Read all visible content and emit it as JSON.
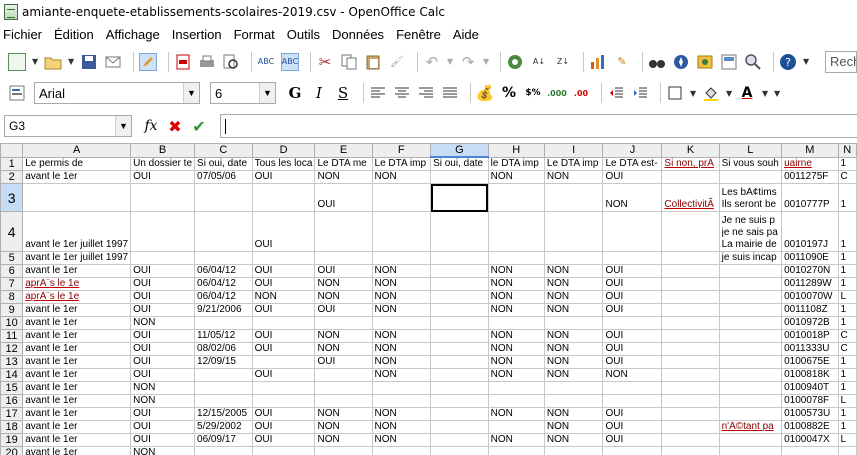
{
  "window": {
    "title": "amiante-enquete-etablissements-scolaires-2019.csv - OpenOffice Calc"
  },
  "menu": [
    "Fichier",
    "Édition",
    "Affichage",
    "Insertion",
    "Format",
    "Outils",
    "Données",
    "Fenêtre",
    "Aide"
  ],
  "search": {
    "placeholder": "Rech"
  },
  "formatting": {
    "font_name": "Arial",
    "font_size": "6",
    "bold_label": "G",
    "italic_label": "I",
    "underline_label": "S",
    "currency": "%",
    "percent": "%"
  },
  "formula_bar": {
    "cell_ref": "G3",
    "fx_label": "fx",
    "value": ""
  },
  "columns": [
    "A",
    "B",
    "C",
    "D",
    "E",
    "F",
    "G",
    "H",
    "I",
    "J",
    "K",
    "L",
    "M",
    "N"
  ],
  "rows": [
    {
      "n": "1",
      "cells": [
        "Le permis de",
        "Un dossier te",
        "Si oui, date",
        "Tous les loca",
        "Le DTA me",
        "Le DTA imp",
        "Si oui, date",
        "le DTA imp",
        "Le DTA imp",
        "Le DTA est-",
        "Si non, prÃ",
        "Si vous souh",
        "uairne",
        "1"
      ]
    },
    {
      "n": "2",
      "cells": [
        "avant le 1er",
        "OUI",
        "07/05/06",
        "OUI",
        "NON",
        "NON",
        "",
        "NON",
        "NON",
        "OUI",
        "",
        "",
        "0011275F",
        "C"
      ]
    },
    {
      "n": "3",
      "cells": [
        "",
        "",
        "",
        "",
        "OUI",
        "",
        "",
        "",
        "",
        "NON",
        "CollectivitÃ",
        "Les bÃ¢tims|Ils seront be",
        "0010777P",
        "1"
      ]
    },
    {
      "n": "4",
      "cells": [
        "avant le 1er juillet 1997",
        "",
        "",
        "OUI",
        "",
        "",
        "",
        "",
        "",
        "",
        "",
        "Je ne suis p|je ne sais pa|La mairie de",
        "0010197J",
        "1"
      ]
    },
    {
      "n": "5",
      "cells": [
        "avant le 1er juillet 1997",
        "",
        "",
        "",
        "",
        "",
        "",
        "",
        "",
        "",
        "",
        "je suis incap",
        "0011090E",
        "1"
      ]
    },
    {
      "n": "6",
      "cells": [
        "avant le 1er",
        "OUI",
        "06/04/12",
        "OUI",
        "OUI",
        "NON",
        "",
        "NON",
        "NON",
        "OUI",
        "",
        "",
        "0010270N",
        "1"
      ]
    },
    {
      "n": "7",
      "cells": [
        "aprÃ¨s le 1e",
        "OUI",
        "06/04/12",
        "OUI",
        "NON",
        "NON",
        "",
        "NON",
        "NON",
        "OUI",
        "",
        "",
        "0011289W",
        "1"
      ]
    },
    {
      "n": "8",
      "cells": [
        "aprÃ¨s le 1e",
        "OUI",
        "06/04/12",
        "NON",
        "NON",
        "NON",
        "",
        "NON",
        "NON",
        "OUI",
        "",
        "",
        "0010070W",
        "L"
      ]
    },
    {
      "n": "9",
      "cells": [
        "avant le 1er",
        "OUI",
        "9/21/2006",
        "OUI",
        "OUI",
        "NON",
        "",
        "NON",
        "NON",
        "OUI",
        "",
        "",
        "0011108Z",
        "1"
      ]
    },
    {
      "n": "10",
      "cells": [
        "avant le 1er",
        "NON",
        "",
        "",
        "",
        "",
        "",
        "",
        "",
        "",
        "",
        "",
        "0010972B",
        "1"
      ]
    },
    {
      "n": "11",
      "cells": [
        "avant le 1er",
        "OUI",
        "11/05/12",
        "OUI",
        "NON",
        "NON",
        "",
        "NON",
        "NON",
        "OUI",
        "",
        "",
        "0010018P",
        "C"
      ]
    },
    {
      "n": "12",
      "cells": [
        "avant le 1er",
        "OUI",
        "08/02/06",
        "OUI",
        "NON",
        "NON",
        "",
        "NON",
        "NON",
        "OUI",
        "",
        "",
        "0011333U",
        "C"
      ]
    },
    {
      "n": "13",
      "cells": [
        "avant le 1er",
        "OUI",
        "12/09/15",
        "",
        "OUI",
        "NON",
        "",
        "NON",
        "NON",
        "OUI",
        "",
        "",
        "0100675E",
        "1"
      ]
    },
    {
      "n": "14",
      "cells": [
        "avant le 1er",
        "OUI",
        "",
        "OUI",
        "",
        "NON",
        "",
        "NON",
        "NON",
        "NON",
        "",
        "",
        "0100818K",
        "1"
      ]
    },
    {
      "n": "15",
      "cells": [
        "avant le 1er",
        "NON",
        "",
        "",
        "",
        "",
        "",
        "",
        "",
        "",
        "",
        "",
        "0100940T",
        "1"
      ]
    },
    {
      "n": "16",
      "cells": [
        "avant le 1er",
        "NON",
        "",
        "",
        "",
        "",
        "",
        "",
        "",
        "",
        "",
        "",
        "0100078F",
        "L"
      ]
    },
    {
      "n": "17",
      "cells": [
        "avant le 1er",
        "OUI",
        "12/15/2005",
        "OUI",
        "NON",
        "NON",
        "",
        "NON",
        "NON",
        "OUI",
        "",
        "",
        "0100573U",
        "1"
      ]
    },
    {
      "n": "18",
      "cells": [
        "avant le 1er",
        "OUI",
        "5/29/2002",
        "OUI",
        "NON",
        "NON",
        "",
        "",
        "NON",
        "OUI",
        "",
        "n'Ã©tant pa",
        "0100882E",
        "1"
      ]
    },
    {
      "n": "19",
      "cells": [
        "avant le 1er",
        "OUI",
        "06/09/17",
        "OUI",
        "NON",
        "NON",
        "",
        "NON",
        "NON",
        "OUI",
        "",
        "",
        "0100047X",
        "L"
      ]
    },
    {
      "n": "20",
      "cells": [
        "avant le 1er",
        "NON",
        "",
        "",
        "",
        "",
        "",
        "",
        "",
        "",
        "",
        "",
        "",
        ""
      ]
    }
  ]
}
